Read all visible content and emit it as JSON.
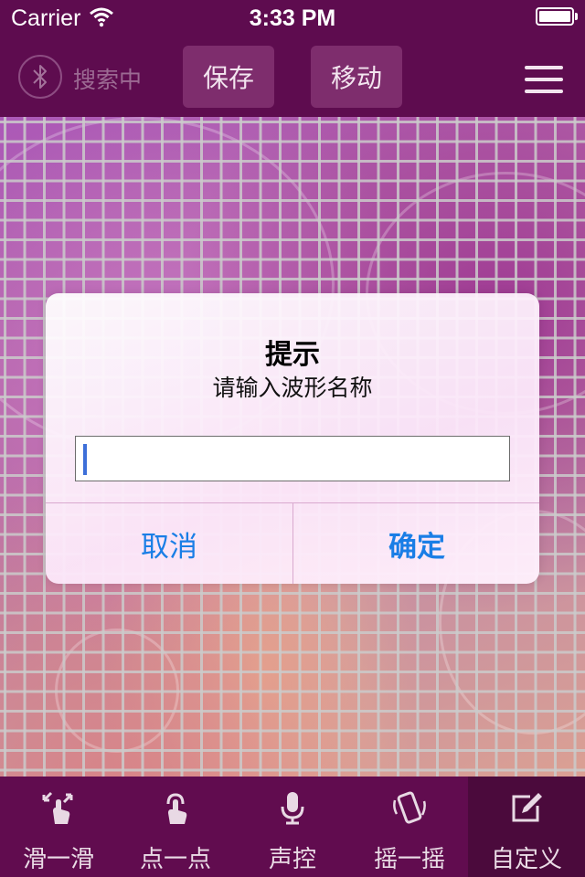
{
  "status_bar": {
    "carrier": "Carrier",
    "time": "3:33 PM"
  },
  "nav": {
    "bluetooth_icon": "bluetooth-icon",
    "search_status": "搜索中",
    "save_label": "保存",
    "move_label": "移动",
    "menu_icon": "hamburger-menu-icon"
  },
  "dialog": {
    "title": "提示",
    "message": "请输入波形名称",
    "input_value": "",
    "cancel_label": "取消",
    "confirm_label": "确定"
  },
  "tabs": [
    {
      "label": "滑一滑",
      "icon": "swipe-gesture-icon"
    },
    {
      "label": "点一点",
      "icon": "tap-gesture-icon"
    },
    {
      "label": "声控",
      "icon": "microphone-icon"
    },
    {
      "label": "摇一摇",
      "icon": "shake-phone-icon"
    },
    {
      "label": "自定义",
      "icon": "edit-square-icon"
    }
  ],
  "colors": {
    "bar_background": "#5e0c4f",
    "nav_button": "#7e2d6d",
    "active_tab": "#4b0a3c",
    "dialog_button_text": "#1a7ee6"
  }
}
